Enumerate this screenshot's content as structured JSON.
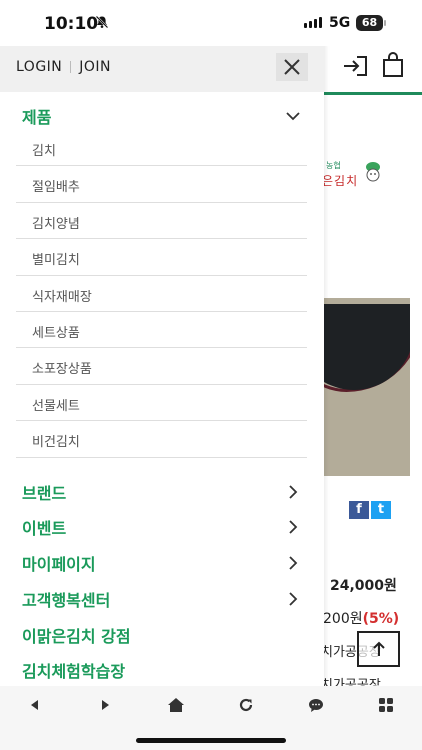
{
  "status_bar": {
    "time": "10:10",
    "network": "5G",
    "battery": "68"
  },
  "drawer": {
    "login_label": "LOGIN",
    "join_label": "JOIN",
    "expanded_category": "제품",
    "product_items": [
      "김치",
      "절임배추",
      "김치양념",
      "별미김치",
      "식자재매장",
      "세트상품",
      "소포장상품",
      "선물세트",
      "비건김치"
    ],
    "categories": [
      {
        "label": "브랜드",
        "has_arrow": true
      },
      {
        "label": "이벤트",
        "has_arrow": true
      },
      {
        "label": "마이페이지",
        "has_arrow": true
      },
      {
        "label": "고객행복센터",
        "has_arrow": true
      },
      {
        "label": "이맑은김치 강점",
        "has_arrow": false
      },
      {
        "label": "김치체험학습장",
        "has_arrow": false
      }
    ]
  },
  "background_page": {
    "logo_small": "농협",
    "logo_text": "은김치",
    "social": [
      "f",
      "t"
    ],
    "price": "24,000원",
    "discount_price": "200원",
    "discount_rate": "(5%)",
    "info_line_1": "치가공공장",
    "info_line_2": "치가공공장"
  },
  "colors": {
    "accent_green": "#1a9a5a",
    "header_line": "#1f8a5b",
    "discount_red": "#d32f2f",
    "facebook_blue": "#3b5998",
    "twitter_blue": "#1da1f2"
  }
}
